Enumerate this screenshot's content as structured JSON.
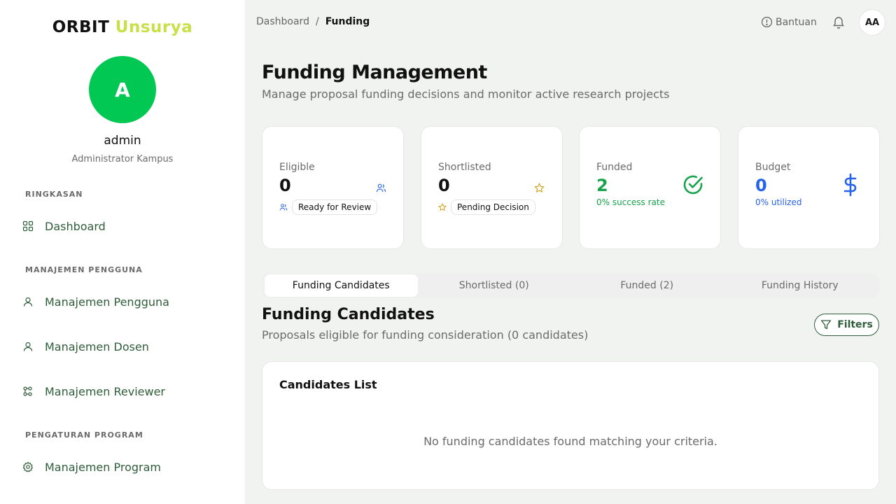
{
  "sidebar": {
    "brand_part1": "ORBIT",
    "brand_part2": "Unsurya",
    "avatar_letter": "A",
    "user_name": "admin",
    "user_role": "Administrator Kampus",
    "sections": [
      {
        "title": "RINGKASAN",
        "items": [
          {
            "label": "Dashboard",
            "icon": "grid-icon"
          }
        ]
      },
      {
        "title": "MANAJEMEN PENGGUNA",
        "items": [
          {
            "label": "Manajemen Pengguna",
            "icon": "user-icon"
          },
          {
            "label": "Manajemen Dosen",
            "icon": "user-icon"
          },
          {
            "label": "Manajemen Reviewer",
            "icon": "network-icon"
          }
        ]
      },
      {
        "title": "PENGATURAN PROGRAM",
        "items": [
          {
            "label": "Manajemen Program",
            "icon": "gear-icon"
          }
        ]
      }
    ]
  },
  "header": {
    "breadcrumb": [
      "Dashboard",
      "Funding"
    ],
    "breadcrumb_sep": "/",
    "help_label": "Bantuan",
    "avatar_initials": "AA"
  },
  "page": {
    "title": "Funding Management",
    "subtitle": "Manage proposal funding decisions and monitor active research projects"
  },
  "stats": [
    {
      "label": "Eligible",
      "value": "0",
      "chip": "Ready for Review",
      "icon": "users-icon",
      "color": "#2563eb"
    },
    {
      "label": "Shortlisted",
      "value": "0",
      "chip": "Pending Decision",
      "icon": "star-icon",
      "color": "#d4a017"
    },
    {
      "label": "Funded",
      "value": "2",
      "sub": "0% success rate",
      "icon": "check-circle-icon",
      "color": "#16a34a"
    },
    {
      "label": "Budget",
      "value": "0",
      "sub": "0% utilized",
      "icon": "dollar-icon",
      "color": "#2563eb"
    }
  ],
  "tabs": [
    {
      "label": "Funding Candidates",
      "active": true
    },
    {
      "label": "Shortlisted (0)",
      "active": false
    },
    {
      "label": "Funded (2)",
      "active": false
    },
    {
      "label": "Funding History",
      "active": false
    }
  ],
  "section": {
    "title": "Funding Candidates",
    "subtitle": "Proposals eligible for funding consideration (0 candidates)",
    "filters_label": "Filters"
  },
  "list": {
    "title": "Candidates List",
    "empty_message": "No funding candidates found matching your criteria."
  }
}
